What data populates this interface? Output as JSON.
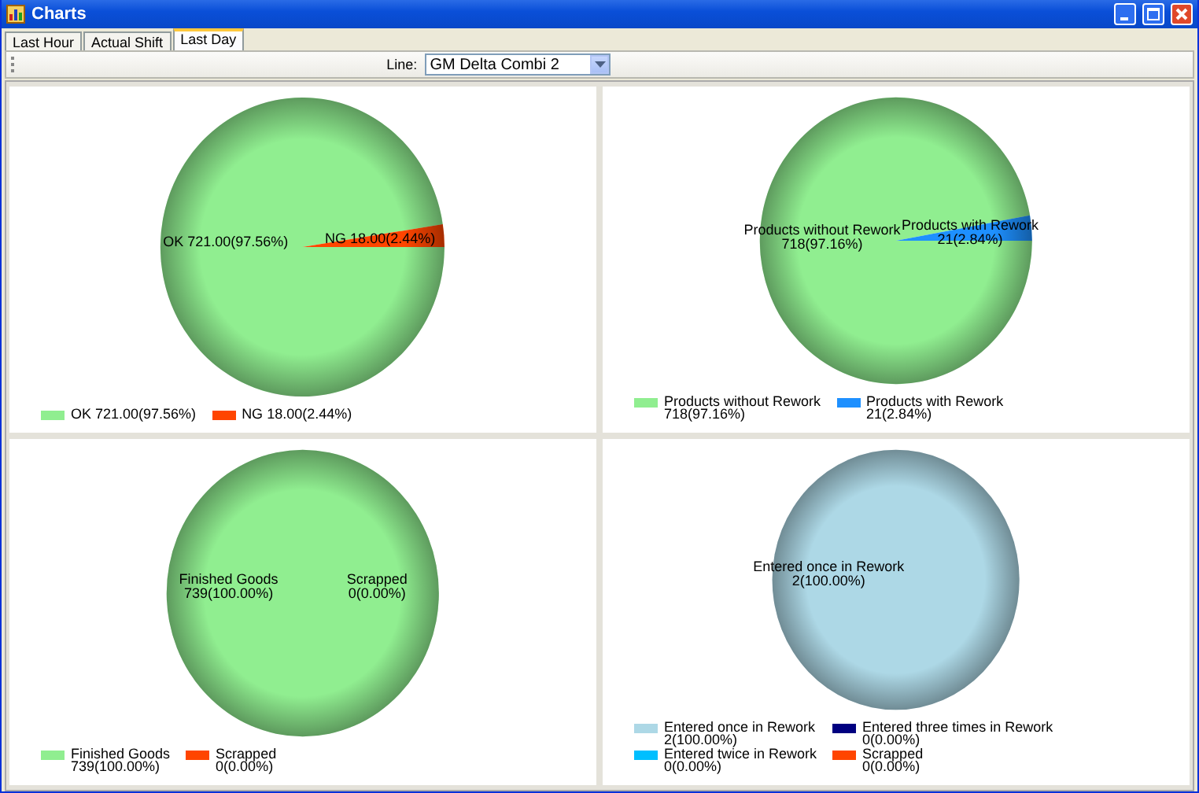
{
  "window": {
    "title": "Charts"
  },
  "tabs": [
    {
      "label": "Last Hour",
      "selected": false
    },
    {
      "label": "Actual Shift",
      "selected": false
    },
    {
      "label": "Last Day",
      "selected": true
    }
  ],
  "toolbar": {
    "line_label": "Line:",
    "line_value": "GM Delta Combi 2"
  },
  "panels": [
    {
      "chart_data": {
        "type": "pie",
        "categories": [
          "OK",
          "NG"
        ],
        "values": [
          721,
          18
        ],
        "value_labels": [
          "721.00(97.56%)",
          "18.00(2.44%)"
        ]
      },
      "kind": "inline",
      "slice_labels": [
        {
          "lines": [
            "OK  721.00(97.56%)"
          ]
        },
        {
          "lines": [
            "NG 18.00(2.44%)"
          ]
        }
      ],
      "legend": [
        {
          "color": "#90ee90"
        },
        {
          "color": "#ff4500"
        }
      ]
    },
    {
      "chart_data": {
        "type": "pie",
        "categories": [
          "Products without Rework",
          "Products with Rework"
        ],
        "values": [
          718,
          21
        ],
        "value_labels": [
          "718(97.16%)",
          "21(2.84%)"
        ]
      },
      "kind": "stacked",
      "slice_labels": [
        {
          "lines": [
            "Products without Rework",
            "718(97.16%)"
          ]
        },
        {
          "lines": [
            "Products with Rework",
            "21(2.84%)"
          ]
        }
      ],
      "legend": [
        {
          "color": "#90ee90"
        },
        {
          "color": "#1e90ff"
        }
      ]
    },
    {
      "chart_data": {
        "type": "pie",
        "categories": [
          "Finished Goods",
          "Scrapped"
        ],
        "values": [
          739,
          0
        ],
        "value_labels": [
          "739(100.00%)",
          "0(0.00%)"
        ]
      },
      "kind": "stacked",
      "slice_labels": [
        {
          "lines": [
            "Finished Goods",
            "739(100.00%)"
          ]
        },
        {
          "lines": [
            "Scrapped",
            "0(0.00%)"
          ]
        }
      ],
      "legend": [
        {
          "color": "#90ee90"
        },
        {
          "color": "#ff4500"
        }
      ]
    },
    {
      "chart_data": {
        "type": "pie",
        "categories": [
          "Entered once in Rework",
          "Entered twice in Rework",
          "Entered three times in Rework",
          "Scrapped"
        ],
        "values": [
          2,
          0,
          0,
          0
        ],
        "value_labels": [
          "2(100.00%)",
          "0(0.00%)",
          "0(0.00%)",
          "0(0.00%)"
        ]
      },
      "kind": "stacked",
      "slice_labels": [
        {
          "lines": [
            "Entered once in Rework",
            "2(100.00%)"
          ]
        }
      ],
      "legend": [
        {
          "color": "#add8e6"
        },
        {
          "color": "#00bfff"
        },
        {
          "color": "#000080"
        },
        {
          "color": "#ff4500"
        }
      ]
    }
  ]
}
